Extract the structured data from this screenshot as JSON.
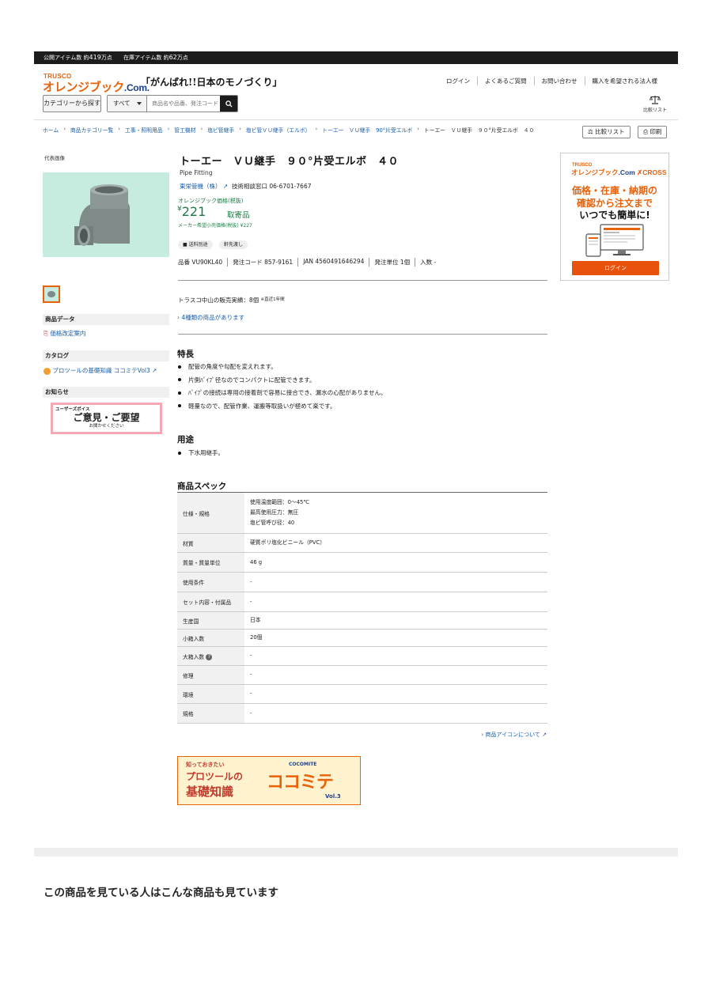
{
  "topbar": {
    "public_label": "公開アイテム数 約",
    "public_count": "419",
    "public_unit": "万点",
    "stock_label": "在庫アイテム数 約",
    "stock_count": "62",
    "stock_unit": "万点"
  },
  "header": {
    "logo_trusco": "TRUSCO",
    "logo_main": "オレンジブック",
    "logo_com": ".Com.",
    "slogan": "「がんばれ!!日本のモノづくり」",
    "links": [
      "ログイン",
      "よくあるご質問",
      "お問い合わせ",
      "購入を希望される法人様"
    ],
    "category_button": "カテゴリーから探す",
    "search_scope": "すべて",
    "search_placeholder": "商品名や品番、発注コード",
    "compare_label": "比較リスト"
  },
  "breadcrumb": [
    "ホーム",
    "商品カテゴリ一覧",
    "工事・照明用品",
    "管工機材",
    "塩ビ管継手",
    "塩ビ管ＶＵ継手（エルボ）",
    "トーエー　ＶＵ継手　90°片受エルボ",
    "トーエー　ＶＵ継手　９０°片受エルボ　４０"
  ],
  "util": {
    "compare_btn": "比較リスト",
    "print_btn": "印刷"
  },
  "left": {
    "rep_image_label": "代表画像",
    "product_data_heading": "商品データ",
    "price_revision_link": "価格改定案内",
    "catalog_heading": "カタログ",
    "catalog_link": "プロツールの基礎知識 ココミテVol3",
    "news_heading": "お知らせ",
    "voice_top": "ユーザーズボイス",
    "voice_main": "ご意見・ご要望",
    "voice_sub": "お聞かせください"
  },
  "product": {
    "title": "トーエー　ＶＵ継手　９０°片受エルボ　４０",
    "english": "Pipe Fitting",
    "maker": "東栄管機（株）",
    "tech_label": "技術相談窓口",
    "tech_phone": "06-6701-7667",
    "price_label": "オレンジブック価格(税抜)",
    "price_symbol": "¥",
    "price": "221",
    "stock_status": "取寄品",
    "maker_price": "メーカー希望小売価格(税抜) ¥227",
    "tags": [
      "送料別途",
      "軒先渡し"
    ],
    "codes": [
      "品番  VU90KL40",
      "発注コード  857-9161",
      "JAN  4560491646294",
      "発注単位  1個",
      "入数  -"
    ],
    "sales_text": "トラスコ中山の販売実績：8個",
    "sales_note": "※直近1年間",
    "variants_link": "4種類の商品があります"
  },
  "features": {
    "heading": "特長",
    "items": [
      "配管の角度や勾配を変えれます。",
      "片側ﾊﾟｲﾌﾟ径なのでコンパクトに配管できます。",
      "ﾊﾟｲﾌﾟの接続は専用の接着剤で容易に接合でき、漏水の心配がありません。",
      "軽量なので、配管作業、運搬等取扱いが極めて楽です。"
    ]
  },
  "usage": {
    "heading": "用途",
    "items": [
      "下水用継手。"
    ]
  },
  "spec": {
    "heading": "商品スペック",
    "rows": [
      {
        "k": "仕様・規格",
        "v1": "使用温度範囲：0～45℃",
        "v2": "最高使用圧力：無圧",
        "v3": "塩ビ管呼び径：40"
      },
      {
        "k": "材質",
        "v1": "硬質ポリ塩化ビニール（PVC）"
      },
      {
        "k": "質量・質量単位",
        "v1": "46 g"
      },
      {
        "k": "使用条件",
        "v1": "-"
      },
      {
        "k": "セット内容・付属品",
        "v1": "-"
      },
      {
        "k": "生産国",
        "v1": "日本"
      },
      {
        "k": "小箱入数",
        "v1": "20個"
      },
      {
        "k": "大箱入数",
        "v1": "-"
      },
      {
        "k": "修理",
        "v1": "-"
      },
      {
        "k": "環境",
        "v1": "-"
      },
      {
        "k": "規格",
        "v1": "-"
      }
    ],
    "info_mark": "?",
    "icon_link": "商品アイコンについて"
  },
  "coco_banner": {
    "l1": "知っておきたい",
    "l2": "プロツールの",
    "l3": "基礎知識",
    "big": "ココミテ",
    "brand": "COCOMITE",
    "vol": "Vol.3"
  },
  "ad": {
    "trusco": "TRUSCO",
    "brand": "オレンジブック",
    "brand_com": ".Com",
    "cross": "✗CROSS",
    "line1": "価格・在庫・納期の",
    "line2": "確認から注文まで",
    "line3": "いつでも簡単に!",
    "login": "ログイン"
  },
  "recommend": {
    "title": "この商品を見ている人はこんな商品も見ています"
  },
  "colors": {
    "brand_orange": "#e8620a",
    "brand_blue": "#1b3f8f",
    "price_green": "#1c7c45",
    "link_blue": "#1a5ea8"
  }
}
